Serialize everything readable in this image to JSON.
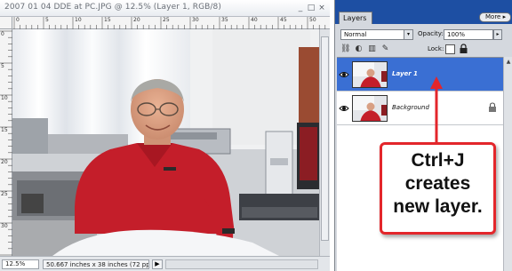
{
  "document": {
    "title": "2007 01 04 DDE at PC.JPG @ 12.5% (Layer 1, RGB/8)",
    "window_buttons": {
      "minimize": "_",
      "maximize": "□",
      "close": "×"
    },
    "ruler_h_numbers": [
      "0",
      "5",
      "10",
      "15",
      "20",
      "25",
      "30",
      "35",
      "40",
      "45",
      "50"
    ],
    "ruler_v_numbers": [
      "0",
      "5",
      "10",
      "15",
      "20",
      "25",
      "30"
    ],
    "status": {
      "zoom": "12.5%",
      "info": "50.667 inches x 38 inches (72 ppi)",
      "arrow": "▶"
    }
  },
  "layers_panel": {
    "tab_label": "Layers",
    "more_label": "More ▸",
    "blend_mode": "Normal",
    "opacity_label": "Opacity:",
    "opacity_value": "100%",
    "lock_label": "Lock:",
    "layers": [
      {
        "name": "Layer 1",
        "selected": true,
        "locked": false
      },
      {
        "name": "Background",
        "selected": false,
        "locked": true
      }
    ]
  },
  "annotation": {
    "lines": [
      "Ctrl+J",
      "creates",
      "new layer."
    ],
    "color": "#e3262b"
  },
  "colors": {
    "panel_title_blue": "#1d4fa3",
    "selected_layer_blue": "#3a6fd3",
    "shirt_red": "#c41e2a"
  },
  "icons": [
    "eye-icon",
    "lock-icon",
    "link-icon",
    "brush-icon",
    "trash-icon",
    "adjustment-icon",
    "scroll-arrow-icon"
  ]
}
